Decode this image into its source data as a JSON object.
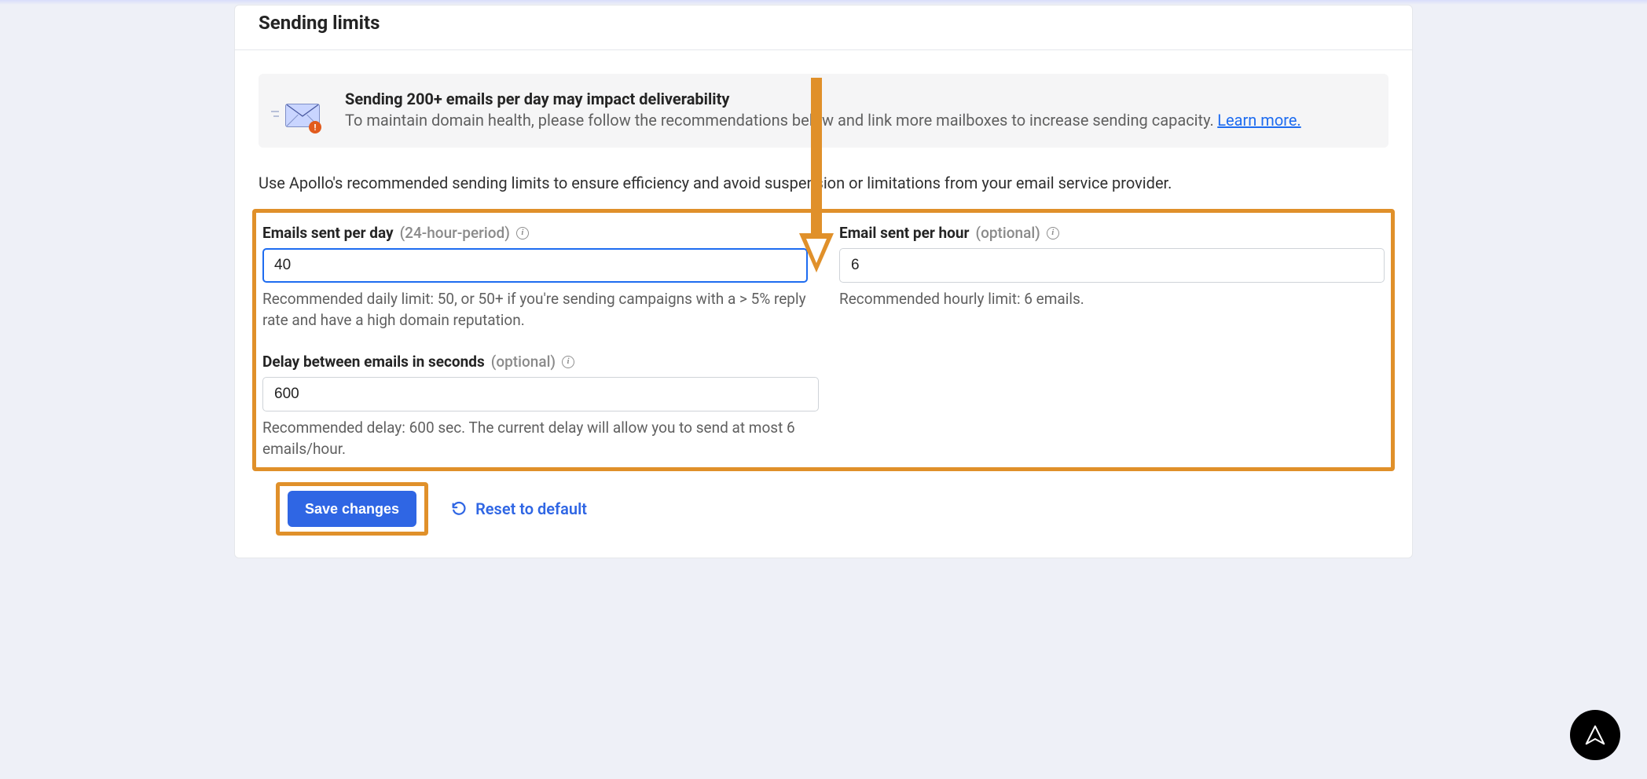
{
  "section": {
    "title": "Sending limits"
  },
  "notice": {
    "title": "Sending 200+ emails per day may impact deliverability",
    "text": "To maintain domain health, please follow the recommendations below and link more mailboxes to increase sending capacity.",
    "learn_more": "Learn more."
  },
  "intro": "Use Apollo's recommended sending limits to ensure efficiency and avoid suspension or limitations from your email service provider.",
  "fields": {
    "per_day": {
      "label": "Emails sent per day",
      "hint": "(24-hour-period)",
      "value": "40",
      "helper": "Recommended daily limit: 50, or 50+ if you're sending campaigns with a > 5% reply rate and have a high domain reputation."
    },
    "per_hour": {
      "label": "Email sent per hour",
      "hint": "(optional)",
      "value": "6",
      "helper": "Recommended hourly limit: 6 emails."
    },
    "delay": {
      "label": "Delay between emails in seconds",
      "hint": "(optional)",
      "value": "600",
      "helper": "Recommended delay: 600 sec. The current delay will allow you to send at most 6 emails/hour."
    }
  },
  "actions": {
    "save": "Save changes",
    "reset": "Reset to default"
  },
  "colors": {
    "accent_blue": "#2f66e4",
    "highlight_orange": "#e0902a"
  }
}
